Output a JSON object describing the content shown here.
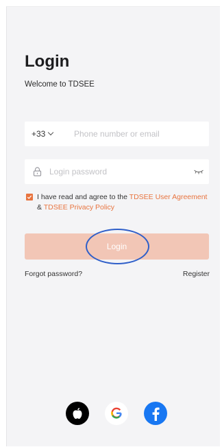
{
  "login": {
    "title": "Login",
    "subtitle": "Welcome to TDSEE"
  },
  "phone_field": {
    "country_code": "+33",
    "placeholder": "Phone number or email",
    "value": ""
  },
  "password_field": {
    "placeholder": "Login password",
    "value": ""
  },
  "agreement": {
    "checked": true,
    "text_prefix": "I have read and agree to the ",
    "user_agreement_link": "TDSEE User Agreement",
    "separator": " & ",
    "privacy_link": "TDSEE Privacy Policy"
  },
  "login_button": {
    "label": "Login"
  },
  "links": {
    "forgot_password": "Forgot password?",
    "register": "Register"
  },
  "social": [
    {
      "icon": "apple-icon"
    },
    {
      "icon": "google-icon"
    },
    {
      "icon": "facebook-icon"
    }
  ],
  "colors": {
    "accent": "#e8743f",
    "login_button_bg": "#f2c6b6",
    "background": "#f4f4f6",
    "annotation_circle": "#2f5fc9",
    "facebook": "#1877f2"
  }
}
